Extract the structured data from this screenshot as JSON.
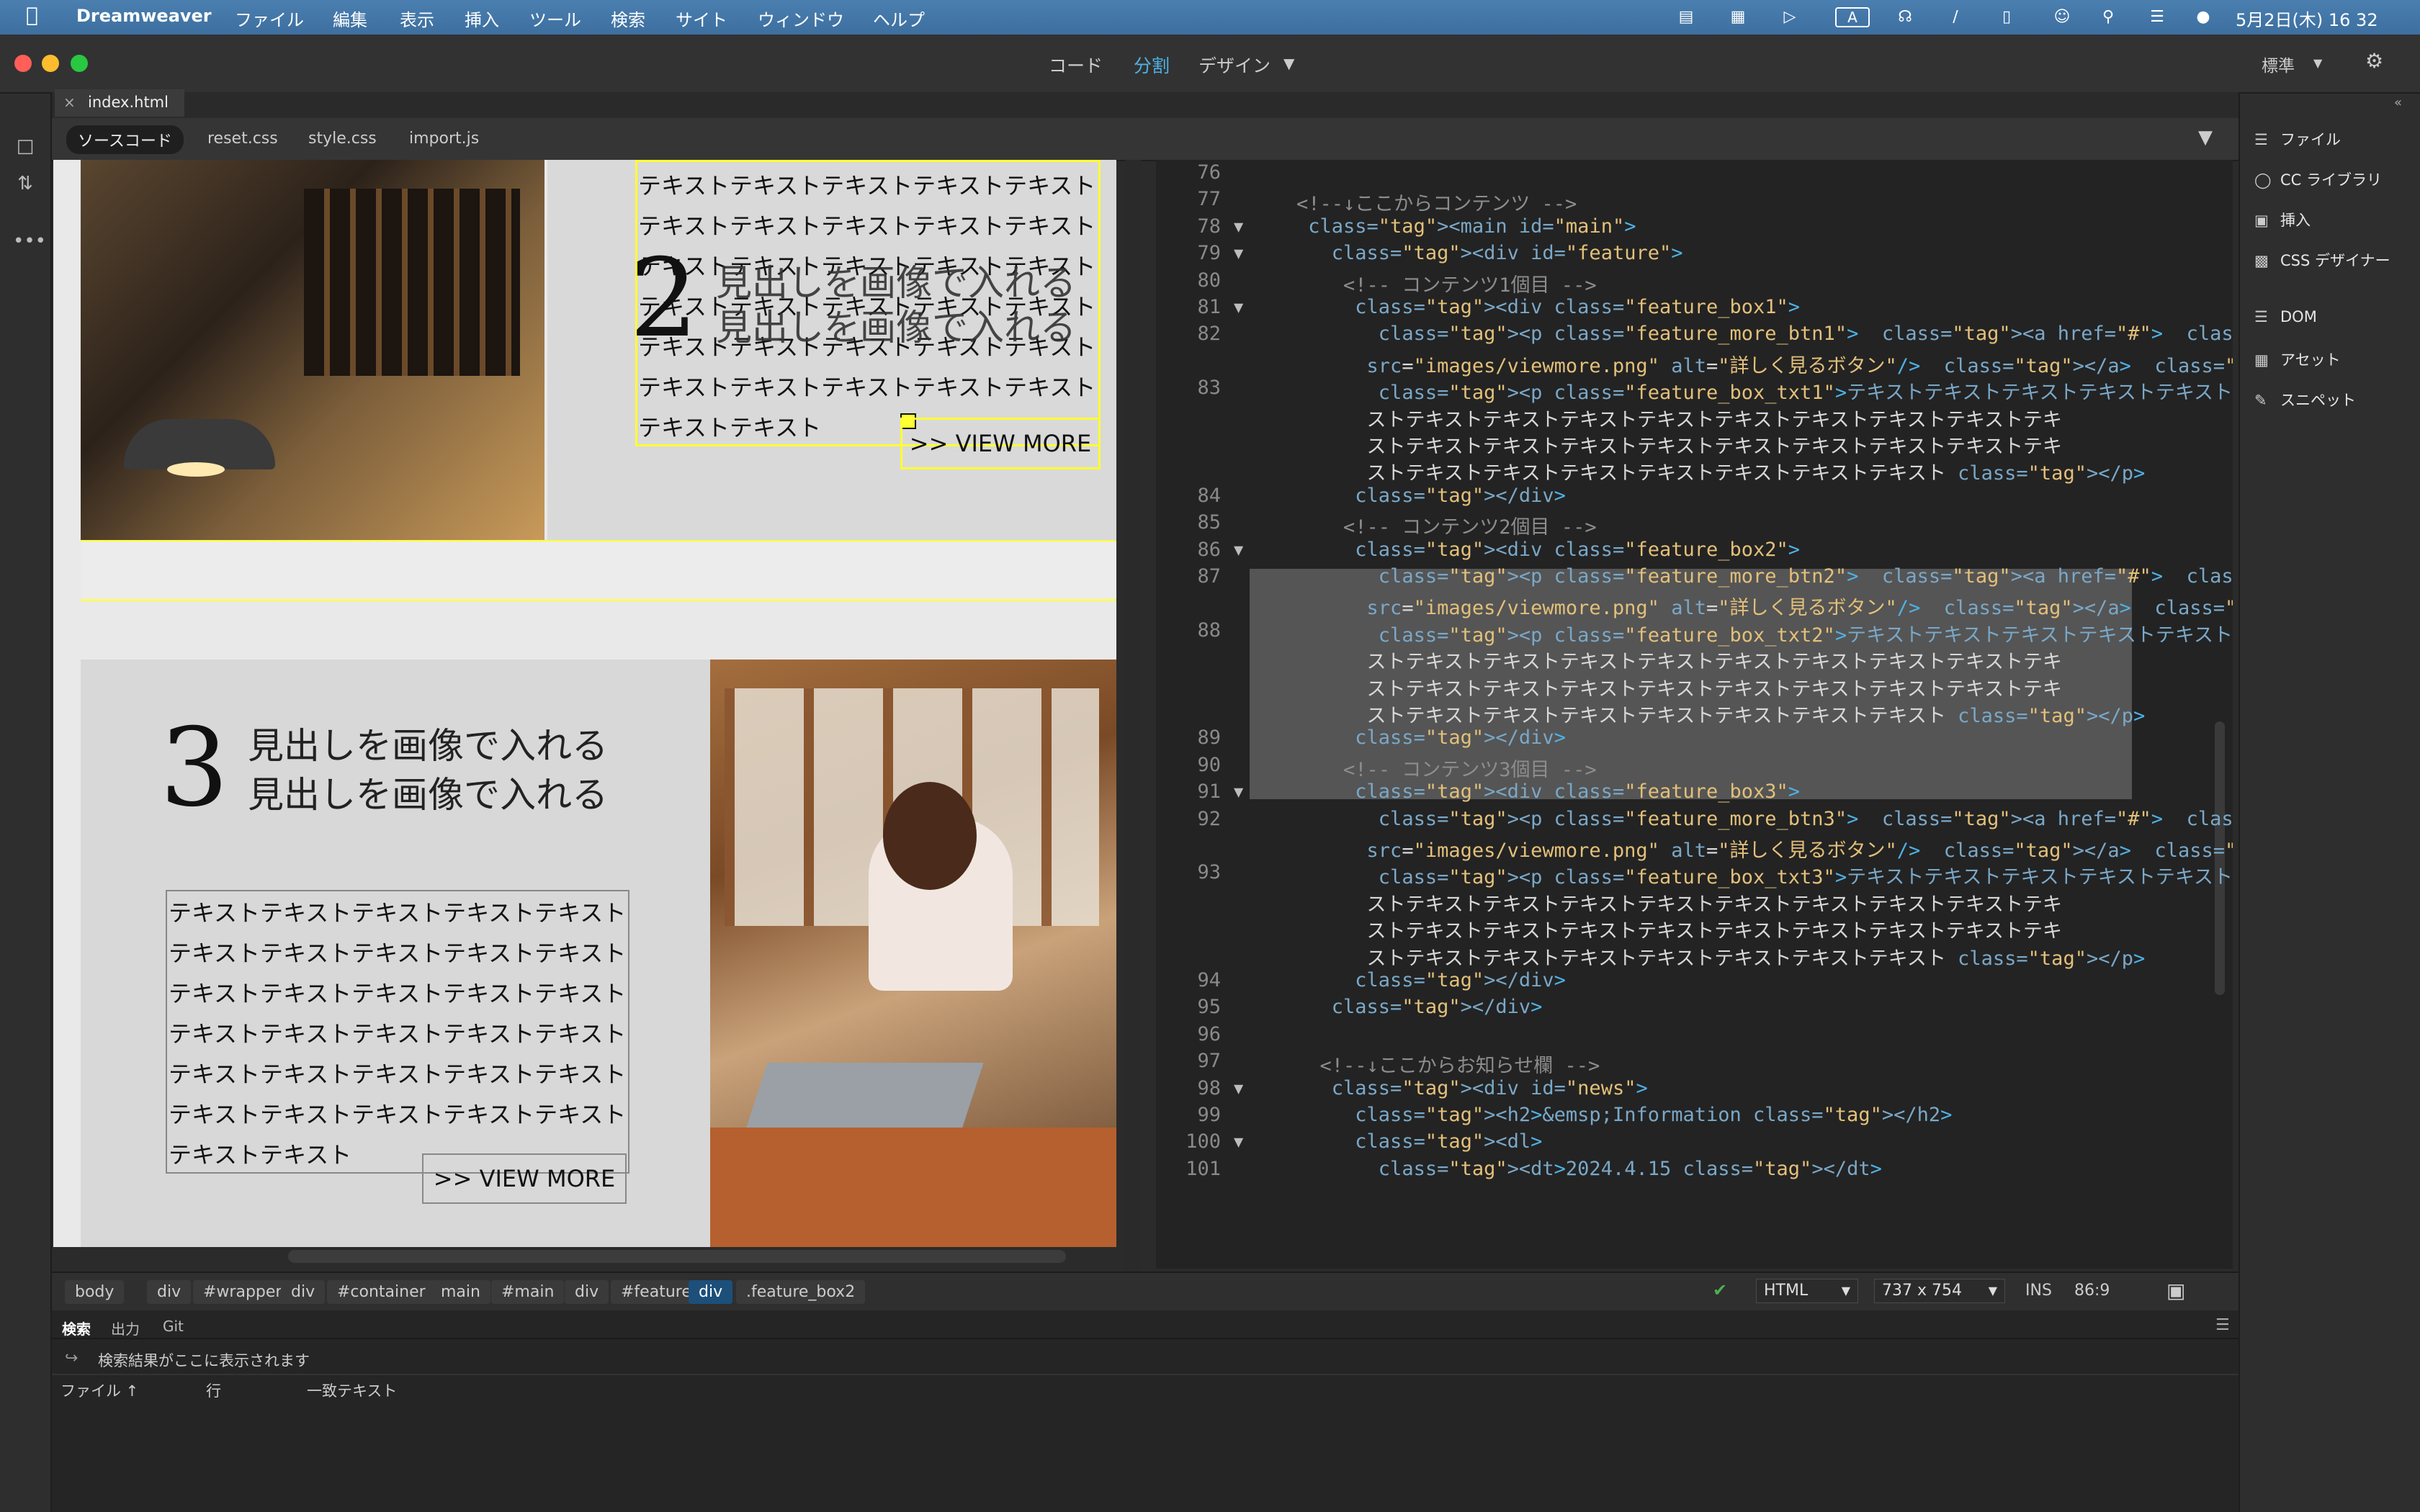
{
  "menubar": {
    "app": "Dreamweaver",
    "items": [
      "ファイル",
      "編集",
      "表示",
      "挿入",
      "ツール",
      "検索",
      "サイト",
      "ウィンドウ",
      "ヘルプ"
    ],
    "clock": "5月2日(木) 16 32"
  },
  "titlebar": {
    "views": {
      "code": "コード",
      "split": "分割",
      "design": "デザイン"
    },
    "workspace": "標準"
  },
  "document": {
    "tab": "index.html",
    "related_files": [
      "ソースコード",
      "reset.css",
      "style.css",
      "import.js"
    ]
  },
  "design_view": {
    "box2": {
      "number": "2",
      "heading": [
        "見出しを画像で入れる",
        "見出しを画像で入れる"
      ],
      "text_lines": [
        "テキストテキストテキストテキストテキスト",
        "テキストテキストテキストテキストテキスト",
        "テキストテキストテキストテキストテキスト",
        "テキストテキストテキストテキストテキスト",
        "テキストテキストテキストテキストテキスト",
        "テキストテキストテキストテキストテキスト",
        "テキストテキスト"
      ],
      "button": ">> VIEW MORE"
    },
    "box3": {
      "number": "3",
      "heading": [
        "見出しを画像で入れる",
        "見出しを画像で入れる"
      ],
      "text_lines": [
        "テキストテキストテキストテキストテキスト",
        "テキストテキストテキストテキストテキスト",
        "テキストテキストテキストテキストテキスト",
        "テキストテキストテキストテキストテキスト",
        "テキストテキストテキストテキストテキスト",
        "テキストテキストテキストテキストテキスト",
        "テキストテキスト"
      ],
      "button": ">> VIEW MORE"
    }
  },
  "code_view": {
    "line_numbers": [
      "76",
      "77",
      "78",
      "79",
      "80",
      "81",
      "82",
      "",
      "83",
      "",
      "",
      "",
      "84",
      "85",
      "86",
      "87",
      "",
      "88",
      "",
      "",
      "",
      "89",
      "90",
      "91",
      "92",
      "",
      "93",
      "",
      "",
      "",
      "94",
      "95",
      "96",
      "97",
      "98",
      "99",
      "100",
      "101"
    ],
    "lines": [
      "",
      "<!--↓ここからコンテンツ -->",
      "<main id=\"main\">",
      "  <div id=\"feature\">",
      "    <!-- コンテンツ1個目 -->",
      "    <div class=\"feature_box1\">",
      "      <p class=\"feature_more_btn1\"> <a href=\"#\"> <img",
      "      src=\"images/viewmore.png\" alt=\"詳しく見るボタン\"/> </a> </p>",
      "      <p class=\"feature_box_txt1\">テキストテキストテキストテキストテキストテキ",
      "      ストテキストテキストテキストテキストテキストテキストテキストテキストテキ",
      "      ストテキストテキストテキストテキストテキストテキストテキストテキストテキ",
      "      ストテキストテキストテキストテキストテキストテキストテキスト</p>",
      "    </div>",
      "    <!-- コンテンツ2個目 -->",
      "    <div class=\"feature_box2\">",
      "      <p class=\"feature_more_btn2\"> <a href=\"#\"> <img",
      "      src=\"images/viewmore.png\" alt=\"詳しく見るボタン\"/> </a> </p>",
      "      <p class=\"feature_box_txt2\">テキストテキストテキストテキストテキストテキ",
      "      ストテキストテキストテキストテキストテキストテキストテキストテキストテキ",
      "      ストテキストテキストテキストテキストテキストテキストテキストテキストテキ",
      "      ストテキストテキストテキストテキストテキストテキストテキスト</p>",
      "    </div>",
      "    <!-- コンテンツ3個目 -->",
      "    <div class=\"feature_box3\">",
      "      <p class=\"feature_more_btn3\"> <a href=\"#\"> <img",
      "      src=\"images/viewmore.png\" alt=\"詳しく見るボタン\"/> </a> </p>",
      "      <p class=\"feature_box_txt3\">テキストテキストテキストテキストテキストテキ",
      "      ストテキストテキストテキストテキストテキストテキストテキストテキストテキ",
      "      ストテキストテキストテキストテキストテキストテキストテキストテキストテキ",
      "      ストテキストテキストテキストテキストテキストテキストテキスト</p>",
      "    </div>",
      "  </div>",
      "",
      "  <!--↓ここからお知らせ欄 -->",
      "  <div id=\"news\">",
      "    <h2>&emsp;Information</h2>",
      "    <dl>",
      "      <dt>2024.4.15</dt>"
    ]
  },
  "right_panel": {
    "items": [
      "ファイル",
      "CC ライブラリ",
      "挿入",
      "CSS デザイナー",
      "DOM",
      "アセット",
      "スニペット"
    ]
  },
  "status_bar": {
    "breadcrumbs": [
      "body",
      "div",
      "#wrapper",
      "div",
      "#container",
      "main",
      "#main",
      "div",
      "#feature",
      "div",
      ".feature_box2"
    ],
    "language": "HTML",
    "size": "737 x 754",
    "mode": "INS",
    "position": "86:9"
  },
  "bottom_panel": {
    "tabs": [
      "検索",
      "出力",
      "Git"
    ],
    "message": "検索結果がここに表示されます",
    "columns": [
      "ファイル ↑",
      "行",
      "一致テキスト"
    ]
  },
  "colors": {
    "accent": "#4fb2e6",
    "selection": "#ffff33"
  }
}
